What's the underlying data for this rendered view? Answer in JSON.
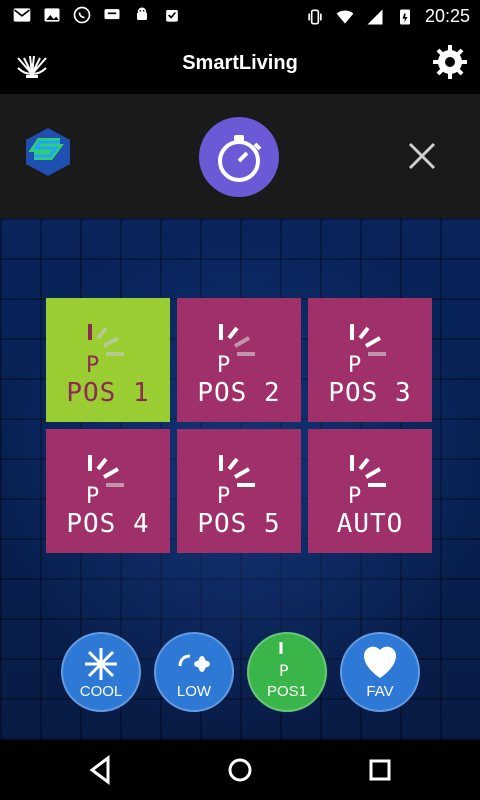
{
  "status": {
    "time": "20:25"
  },
  "app": {
    "title": "SmartLiving"
  },
  "tiles": [
    {
      "label": "POS 1"
    },
    {
      "label": "POS 2"
    },
    {
      "label": "POS 3"
    },
    {
      "label": "POS 4"
    },
    {
      "label": "POS 5"
    },
    {
      "label": "AUTO"
    }
  ],
  "controls": {
    "cool": "COOL",
    "low": "LOW",
    "pos1": "POS1",
    "fav": "FAV"
  },
  "colors": {
    "tile_active": "#9acd32",
    "tile_inactive": "#a0306a",
    "text_active": "#8b2a52",
    "text_inactive": "#ffffff",
    "circle_blue": "#2f79d6",
    "circle_green": "#39b54a"
  },
  "icons": {
    "gear": "gear-icon",
    "close": "close-icon",
    "timer": "stopwatch-icon",
    "logo": "s-logo-icon",
    "brand": "shell-logo-icon"
  }
}
